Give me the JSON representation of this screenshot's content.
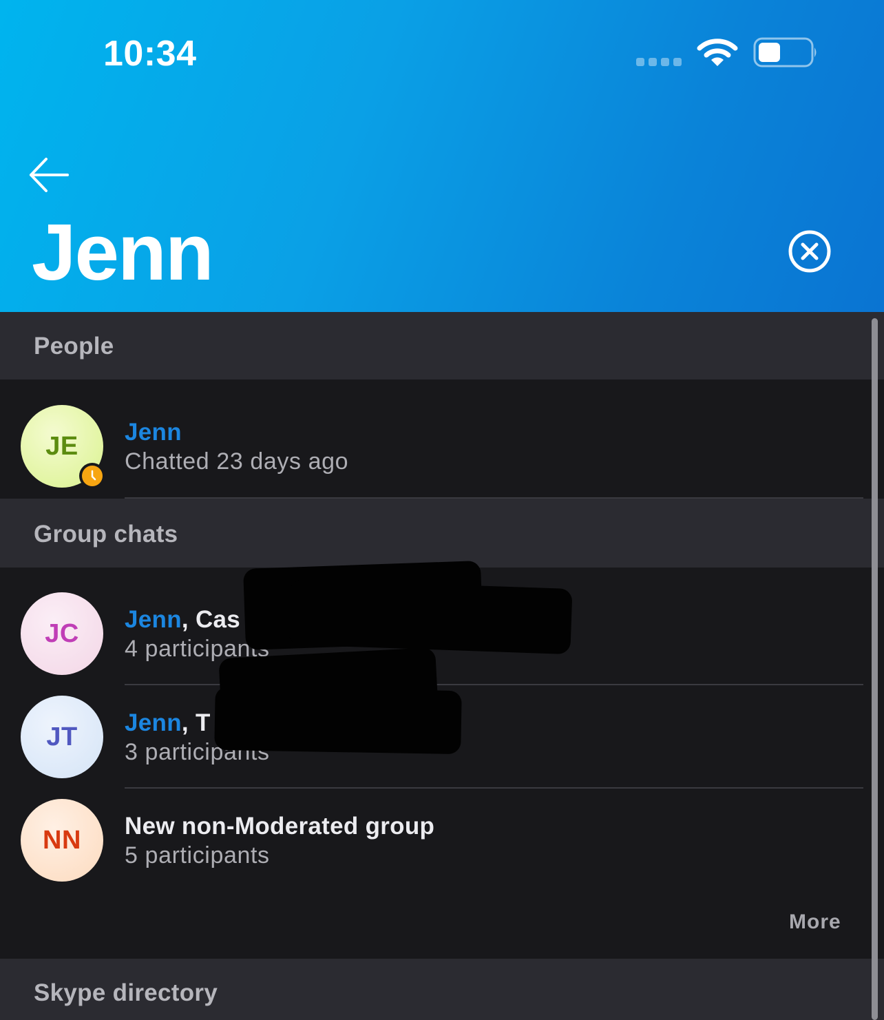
{
  "status_bar": {
    "time": "10:34",
    "signal_icon": "cellular-signal-icon",
    "wifi_icon": "wifi-icon",
    "battery_icon": "battery-icon",
    "battery_level_percent": 40
  },
  "header": {
    "back_icon": "arrow-left-icon",
    "search_query": "Jenn",
    "clear_icon": "close-circle-icon",
    "gradient_start": "#00b4ee",
    "gradient_end": "#0a74d2"
  },
  "sections": {
    "people": {
      "title": "People",
      "items": [
        {
          "initials": "JE",
          "name": "Jenn",
          "subtitle": "Chatted 23 days ago",
          "presence": "away",
          "presence_icon": "clock-icon"
        }
      ]
    },
    "group_chats": {
      "title": "Group chats",
      "items": [
        {
          "initials": "JC",
          "name_highlight": "Jenn",
          "name_rest": ", Cas",
          "subtitle": "4 participants"
        },
        {
          "initials": "JT",
          "name_highlight": "Jenn",
          "name_rest": ", T",
          "subtitle": "3 participants"
        },
        {
          "initials": "NN",
          "name_highlight": "",
          "name_rest": "New non-Moderated group",
          "subtitle": "5 participants"
        }
      ],
      "more_label": "More"
    },
    "directory": {
      "title": "Skype directory"
    }
  },
  "colors": {
    "highlight": "#1c86e0",
    "background": "#18181b",
    "section_header_bg": "#2b2b31",
    "presence_away": "#f7a512"
  }
}
